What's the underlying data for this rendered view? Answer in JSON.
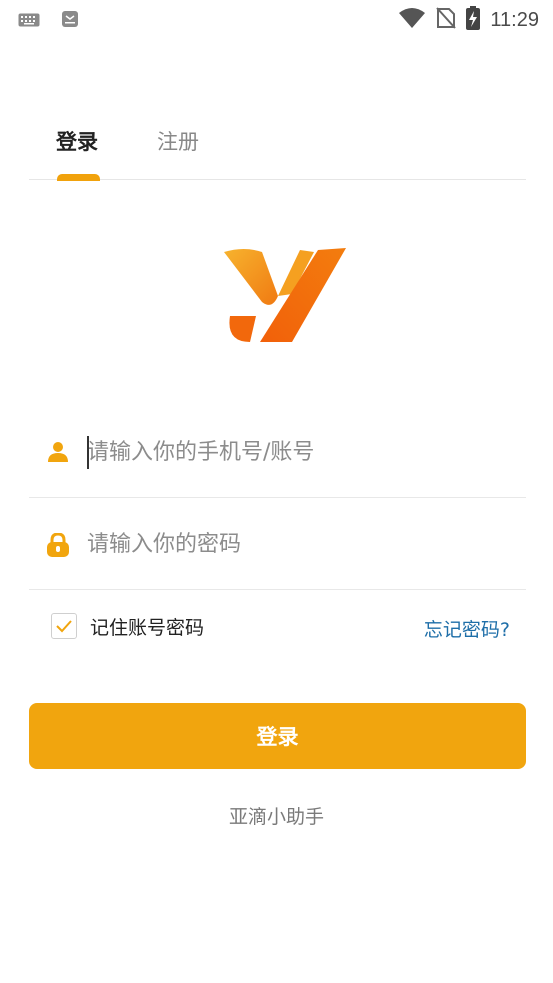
{
  "status_bar": {
    "time": "11:29",
    "icons": [
      "keyboard-icon",
      "notification-icon",
      "wifi-icon",
      "no-sim-icon",
      "battery-charging-icon"
    ]
  },
  "tabs": {
    "login_label": "登录",
    "register_label": "注册",
    "active": "login"
  },
  "logo": {
    "name": "yadi-logo-icon",
    "colors": [
      "#f5a623",
      "#f06a0c"
    ]
  },
  "form": {
    "phone_placeholder": "请输入你的手机号/账号",
    "phone_value": "",
    "password_placeholder": "请输入你的密码",
    "password_value": "",
    "remember_label": "记住账号密码",
    "remember_checked": true,
    "forgot_label": "忘记密码?"
  },
  "login_button_label": "登录",
  "footer_brand": "亚滴小助手",
  "colors": {
    "accent": "#f1a50e",
    "link": "#1e6ea8"
  }
}
